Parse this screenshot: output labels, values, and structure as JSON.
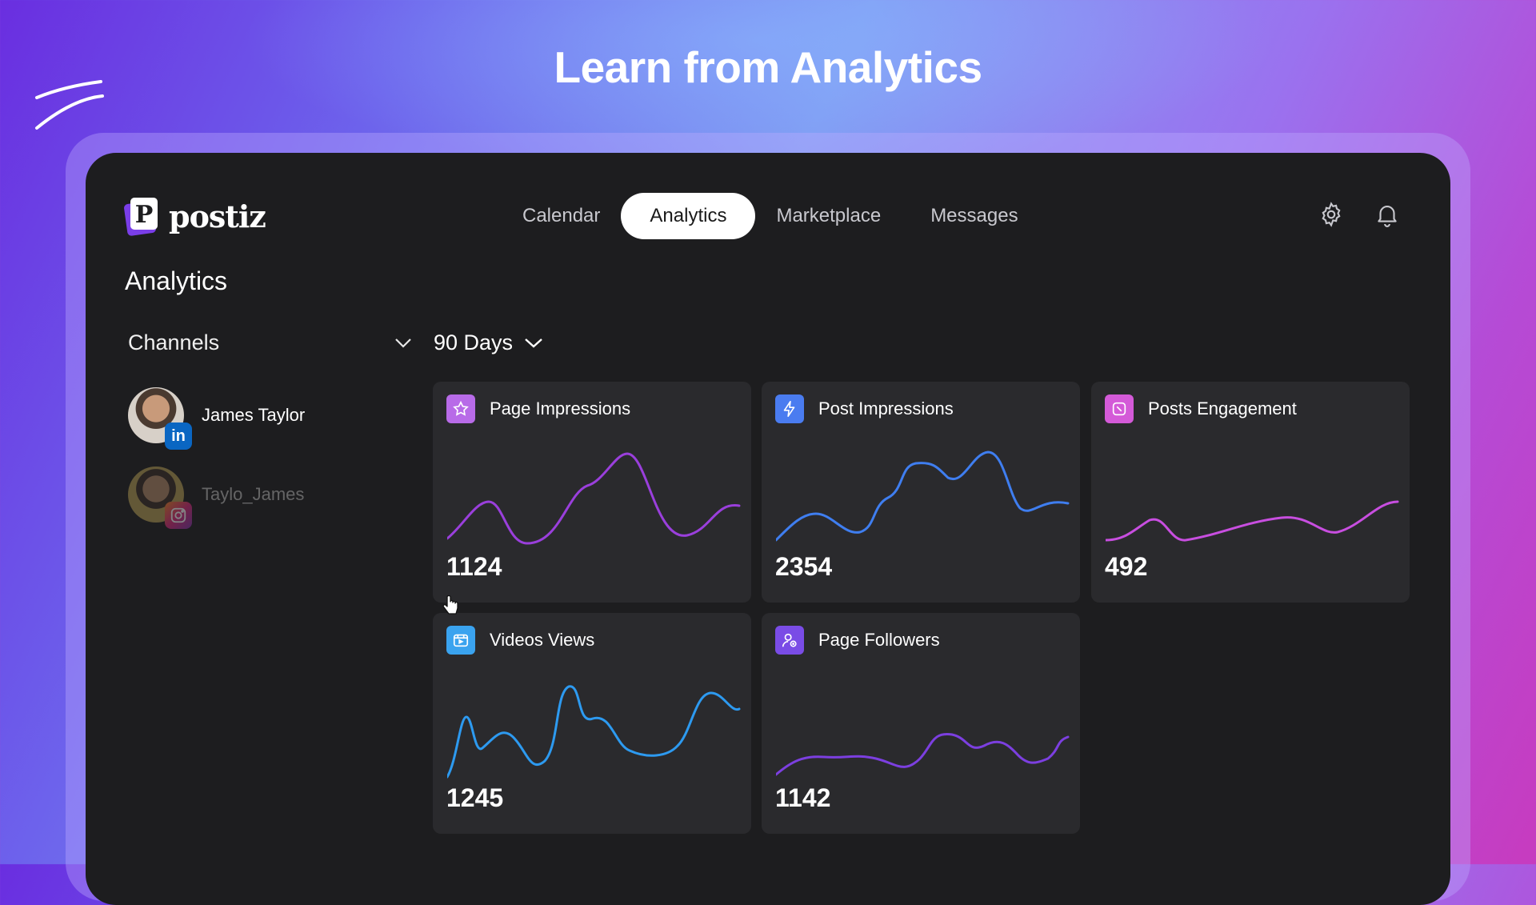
{
  "headline": "Learn from Analytics",
  "logo": {
    "text": "postiz",
    "mark_letter": "P"
  },
  "nav": [
    {
      "label": "Calendar",
      "active": false
    },
    {
      "label": "Analytics",
      "active": true
    },
    {
      "label": "Marketplace",
      "active": false
    },
    {
      "label": "Messages",
      "active": false
    }
  ],
  "top_icons": [
    "gear-icon",
    "bell-icon"
  ],
  "page_title": "Analytics",
  "channels": {
    "label": "Channels",
    "items": [
      {
        "name": "James Taylor",
        "network": "linkedin",
        "active": true
      },
      {
        "name": "Taylo_James",
        "network": "instagram",
        "active": false
      }
    ]
  },
  "period": {
    "selected": "90 Days"
  },
  "cards": [
    {
      "title": "Page Impressions",
      "value": "1124",
      "icon": "star-icon",
      "icon_color": "#b86be8",
      "line_color": "#9a3fdc"
    },
    {
      "title": "Post Impressions",
      "value": "2354",
      "icon": "bolt-icon",
      "icon_color": "#4a7cf0",
      "line_color": "#3f7ef0"
    },
    {
      "title": "Posts Engagement",
      "value": "492",
      "icon": "engagement-icon",
      "icon_color": "#d45ad8",
      "line_color": "#c84ee0"
    },
    {
      "title": "Videos Views",
      "value": "1245",
      "icon": "video-icon",
      "icon_color": "#3aa3ef",
      "line_color": "#2d9af0"
    },
    {
      "title": "Page Followers",
      "value": "1142",
      "icon": "followers-icon",
      "icon_color": "#7a4ce6",
      "line_color": "#7c3fe0"
    }
  ]
}
